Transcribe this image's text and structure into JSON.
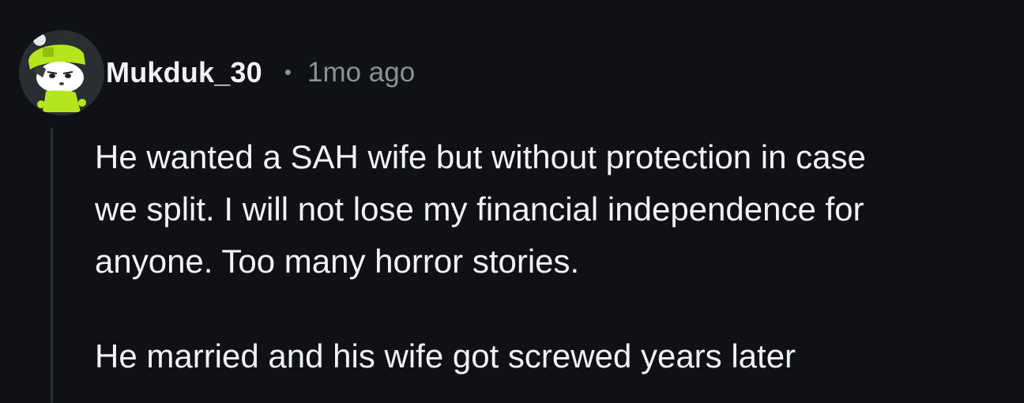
{
  "comment": {
    "author": "Mukduk_30",
    "separator": "•",
    "timestamp": "1mo ago",
    "paragraphs": [
      "He wanted a SAH wife but without protection in case\nwe split. I will not lose my financial independence for\nanyone. Too many horror stories.",
      "He married and his wife got screwed years later"
    ],
    "avatar_icon": "snoo-avatar-green-beanie"
  },
  "colors": {
    "background": "#0f1114",
    "text": "#f2f3f5",
    "meta": "#8b9197",
    "thread_line": "#2c3036",
    "avatar_green": "#b5e61d"
  }
}
